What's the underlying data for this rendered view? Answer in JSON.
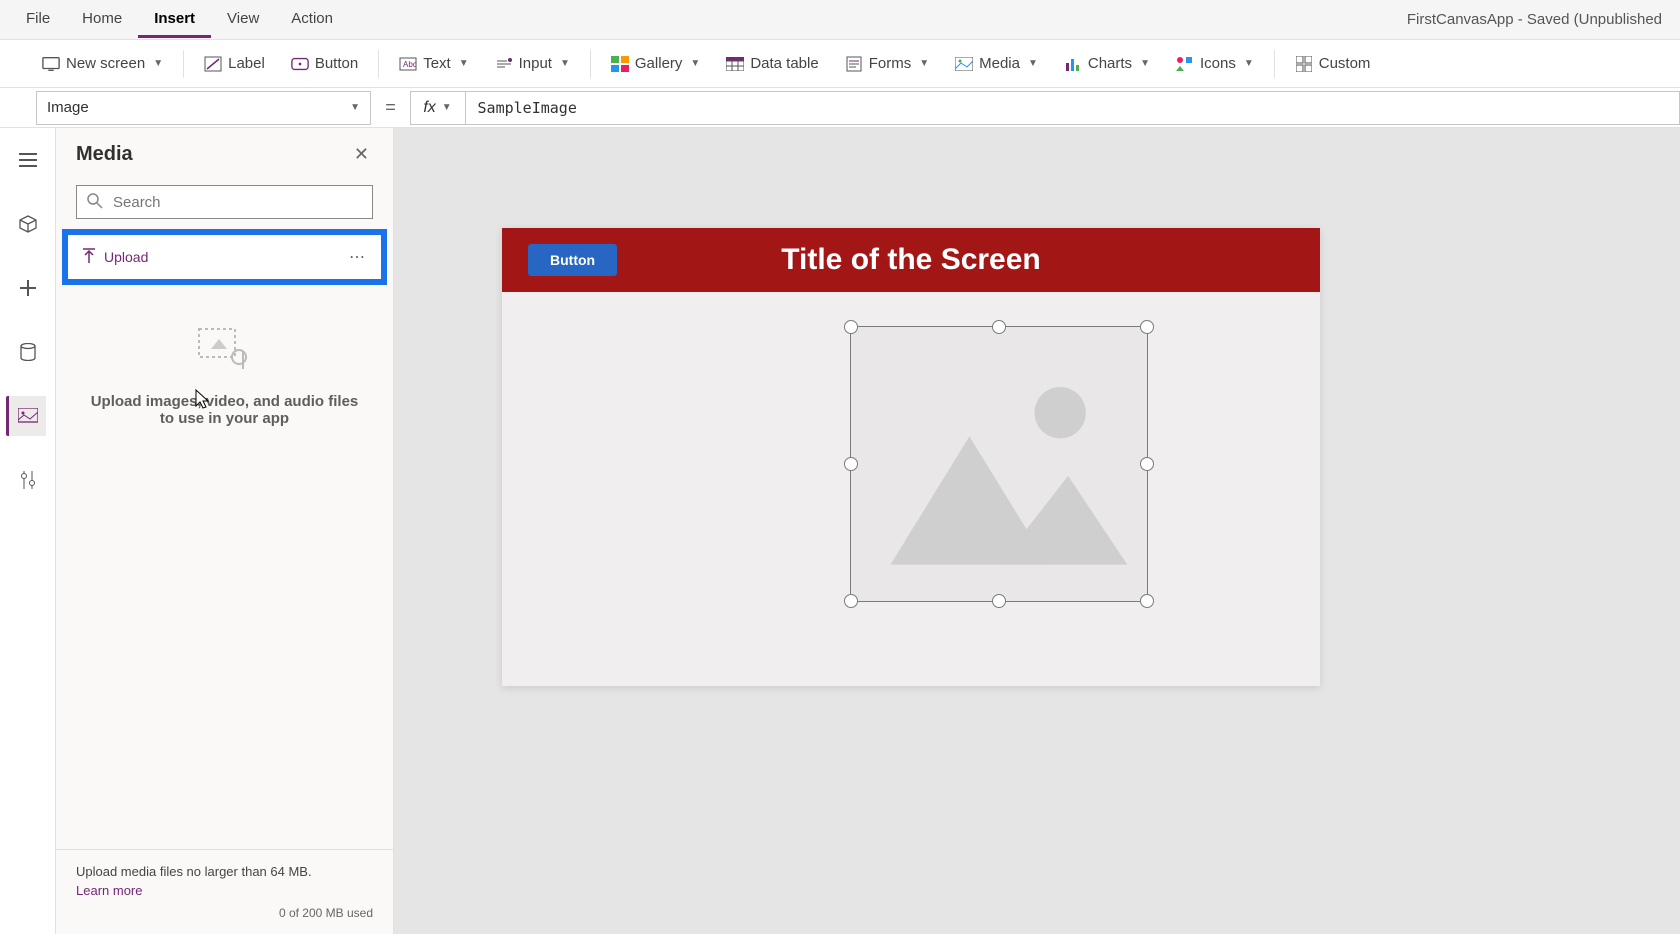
{
  "menubar": {
    "items": [
      "File",
      "Home",
      "Insert",
      "View",
      "Action"
    ],
    "activeIndex": 2,
    "appTitle": "FirstCanvasApp - Saved (Unpublished"
  },
  "ribbon": {
    "newScreen": "New screen",
    "label": "Label",
    "button": "Button",
    "text": "Text",
    "input": "Input",
    "gallery": "Gallery",
    "dataTable": "Data table",
    "forms": "Forms",
    "media": "Media",
    "charts": "Charts",
    "icons": "Icons",
    "custom": "Custom"
  },
  "formulaBar": {
    "property": "Image",
    "equals": "=",
    "fx": "fx",
    "value": "SampleImage"
  },
  "mediaPanel": {
    "title": "Media",
    "searchPlaceholder": "Search",
    "upload": "Upload",
    "emptyText": "Upload images, video, and audio files to use in your app",
    "footerNote": "Upload media files no larger than 64 MB.",
    "learnMore": "Learn more",
    "usage": "0 of 200 MB used"
  },
  "canvas": {
    "buttonLabel": "Button",
    "screenTitle": "Title of the Screen"
  }
}
